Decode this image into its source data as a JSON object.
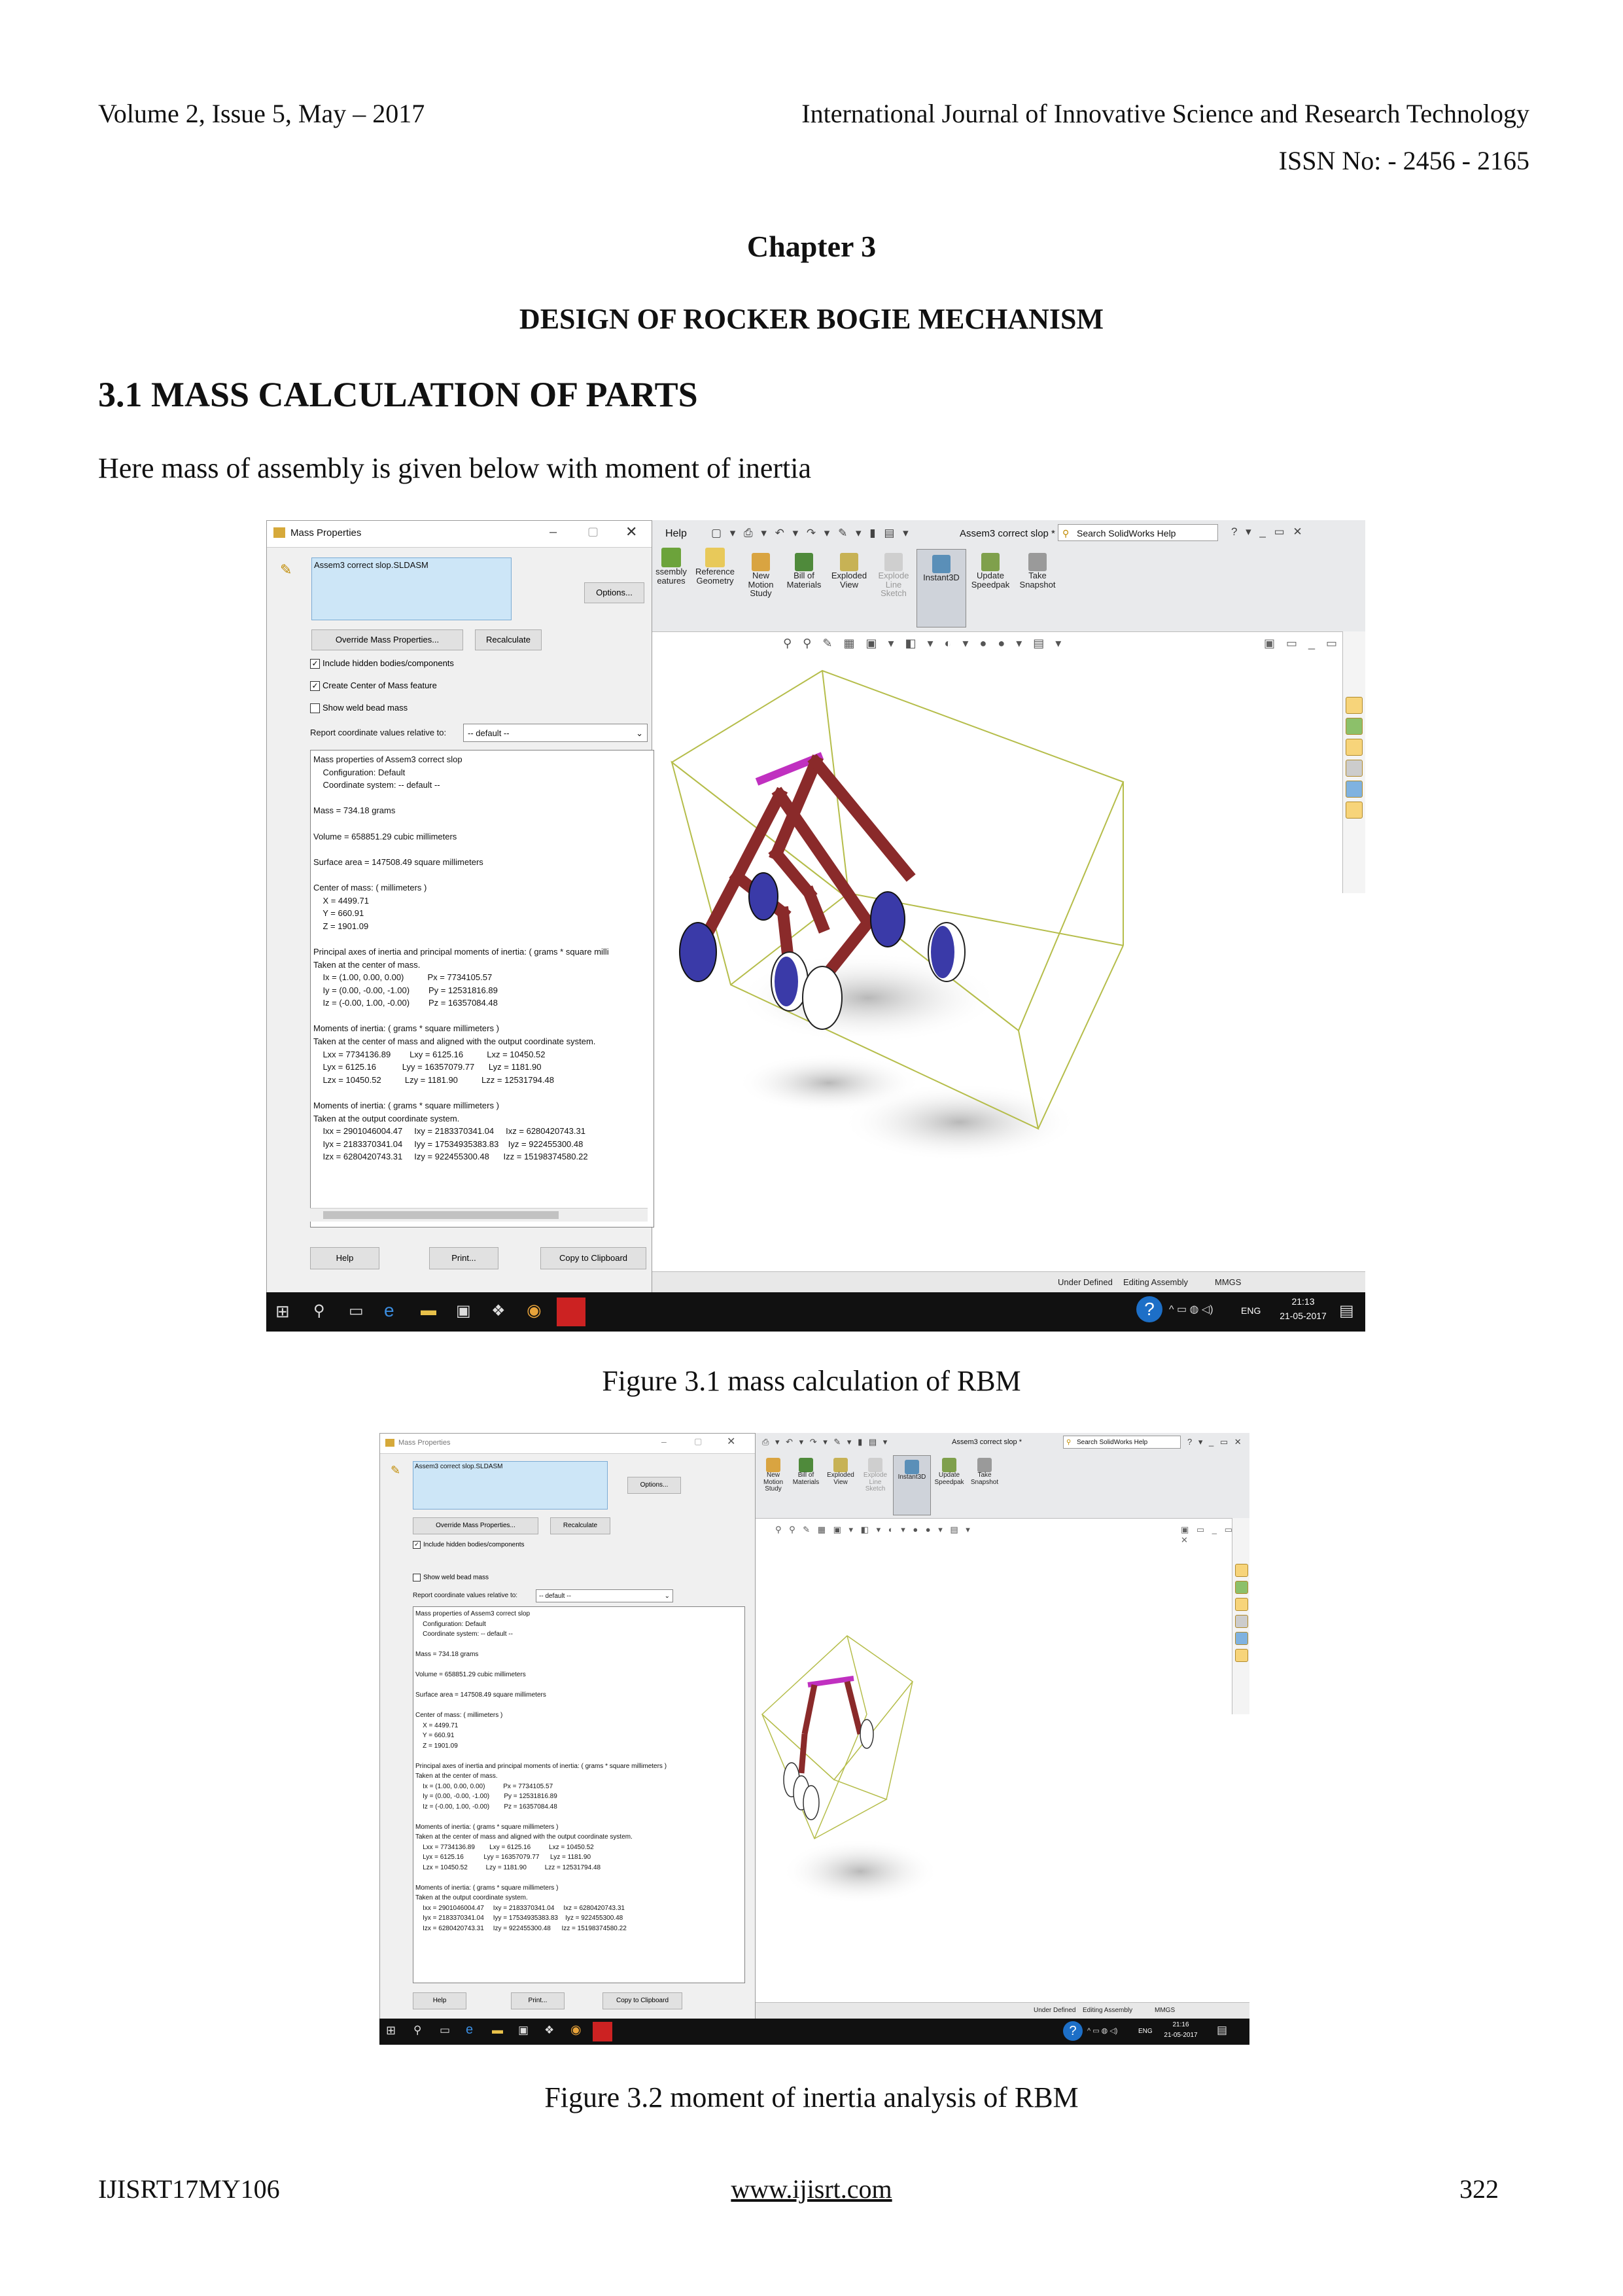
{
  "header": {
    "volume": "Volume 2, Issue 5, May – 2017",
    "journal": "International Journal of Innovative Science and Research Technology",
    "issn": "ISSN No: - 2456 - 2165"
  },
  "chapter": "Chapter 3",
  "chapter_title": "DESIGN OF ROCKER BOGIE MECHANISM",
  "section_heading": "3.1 MASS CALCULATION OF PARTS",
  "intro": "Here mass of assembly is given below with moment of inertia",
  "figure1": {
    "caption": "Figure 3.1 mass calculation of RBM",
    "dialog": {
      "title": "Mass Properties",
      "file": "Assem3 correct slop.SLDASM",
      "options": "Options...",
      "override": "Override Mass Properties...",
      "recalculate": "Recalculate",
      "include_hidden": "Include hidden bodies/components",
      "create_com": "Create Center of Mass feature",
      "show_weld": "Show weld bead mass",
      "report_rel": "Report coordinate values relative to:",
      "coord_default": "-- default --",
      "help": "Help",
      "print": "Print...",
      "copy": "Copy to Clipboard",
      "lines": [
        "Mass properties of Assem3 correct slop",
        "    Configuration: Default",
        "    Coordinate system: -- default --",
        "",
        "Mass = 734.18 grams",
        "",
        "Volume = 658851.29 cubic millimeters",
        "",
        "Surface area = 147508.49 square millimeters",
        "",
        "Center of mass: ( millimeters )",
        "    X = 4499.71",
        "    Y = 660.91",
        "    Z = 1901.09",
        "",
        "Principal axes of inertia and principal moments of inertia: ( grams * square milli",
        "Taken at the center of mass.",
        "    Ix = (1.00, 0.00, 0.00)          Px = 7734105.57",
        "    Iy = (0.00, -0.00, -1.00)        Py = 12531816.89",
        "    Iz = (-0.00, 1.00, -0.00)        Pz = 16357084.48",
        "",
        "Moments of inertia: ( grams * square millimeters )",
        "Taken at the center of mass and aligned with the output coordinate system.",
        "    Lxx = 7734136.89        Lxy = 6125.16          Lxz = 10450.52",
        "    Lyx = 6125.16           Lyy = 16357079.77      Lyz = 1181.90",
        "    Lzx = 10450.52          Lzy = 1181.90          Lzz = 12531794.48",
        "",
        "Moments of inertia: ( grams * square millimeters )",
        "Taken at the output coordinate system.",
        "    Ixx = 2901046004.47     Ixy = 2183370341.04     Ixz = 6280420743.31",
        "    Iyx = 2183370341.04     Iyy = 17534935383.83    Iyz = 922455300.48",
        "    Izx = 6280420743.31     Izy = 922455300.48      Izz = 15198374580.22"
      ]
    },
    "sw": {
      "help_menu": "Help",
      "doc_title": "Assem3 correct slop *",
      "search": "Search SolidWorks Help",
      "ribbon": [
        {
          "label": "ssembly\neatures"
        },
        {
          "label": "Reference\nGeometry"
        },
        {
          "label": "New\nMotion\nStudy"
        },
        {
          "label": "Bill of\nMaterials"
        },
        {
          "label": "Exploded\nView"
        },
        {
          "label": "Explode\nLine\nSketch"
        },
        {
          "label": "Instant3D"
        },
        {
          "label": "Update\nSpeedpak"
        },
        {
          "label": "Take\nSnapshot"
        }
      ],
      "status": [
        "Under Defined",
        "Editing Assembly",
        "MMGS"
      ],
      "time": "21:13",
      "date": "21-05-2017",
      "lang": "ENG"
    }
  },
  "figure2": {
    "caption": "Figure 3.2 moment of inertia  analysis of RBM",
    "dialog": {
      "title": "Mass Properties",
      "file": "Assem3 correct slop.SLDASM",
      "options": "Options...",
      "override": "Override Mass Properties...",
      "recalculate": "Recalculate",
      "include_hidden": "Include hidden bodies/components",
      "show_weld": "Show weld bead mass",
      "report_rel": "Report coordinate values relative to:",
      "coord_default": "-- default --",
      "help": "Help",
      "print": "Print...",
      "copy": "Copy to Clipboard",
      "lines": [
        "Mass properties of Assem3 correct slop",
        "    Configuration: Default",
        "    Coordinate system: -- default --",
        "",
        "Mass = 734.18 grams",
        "",
        "Volume = 658851.29 cubic millimeters",
        "",
        "Surface area = 147508.49 square millimeters",
        "",
        "Center of mass: ( millimeters )",
        "    X = 4499.71",
        "    Y = 660.91",
        "    Z = 1901.09",
        "",
        "Principal axes of inertia and principal moments of inertia: ( grams * square millimeters )",
        "Taken at the center of mass.",
        "    Ix = (1.00, 0.00, 0.00)          Px = 7734105.57",
        "    Iy = (0.00, -0.00, -1.00)        Py = 12531816.89",
        "    Iz = (-0.00, 1.00, -0.00)        Pz = 16357084.48",
        "",
        "Moments of inertia: ( grams * square millimeters )",
        "Taken at the center of mass and aligned with the output coordinate system.",
        "    Lxx = 7734136.89        Lxy = 6125.16          Lxz = 10450.52",
        "    Lyx = 6125.16           Lyy = 16357079.77      Lyz = 1181.90",
        "    Lzx = 10450.52          Lzy = 1181.90          Lzz = 12531794.48",
        "",
        "Moments of inertia: ( grams * square millimeters )",
        "Taken at the output coordinate system.",
        "    Ixx = 2901046004.47     Ixy = 2183370341.04     Ixz = 6280420743.31",
        "    Iyx = 2183370341.04     Iyy = 17534935383.83    Iyz = 922455300.48",
        "    Izx = 6280420743.31     Izy = 922455300.48      Izz = 15198374580.22"
      ]
    },
    "sw": {
      "doc_title": "Assem3 correct slop *",
      "search": "Search SolidWorks Help",
      "ribbon": [
        {
          "label": "New\nMotion\nStudy"
        },
        {
          "label": "Bill of\nMaterials"
        },
        {
          "label": "Exploded\nView"
        },
        {
          "label": "Explode\nLine\nSketch"
        },
        {
          "label": "Instant3D"
        },
        {
          "label": "Update\nSpeedpak"
        },
        {
          "label": "Take\nSnapshot"
        }
      ],
      "status": [
        "Under Defined",
        "Editing Assembly",
        "MMGS"
      ],
      "time": "21:16",
      "date": "21-05-2017",
      "lang": "ENG"
    }
  },
  "footer": {
    "code": "IJISRT17MY106",
    "url": "www.ijisrt.com",
    "page": "322"
  }
}
